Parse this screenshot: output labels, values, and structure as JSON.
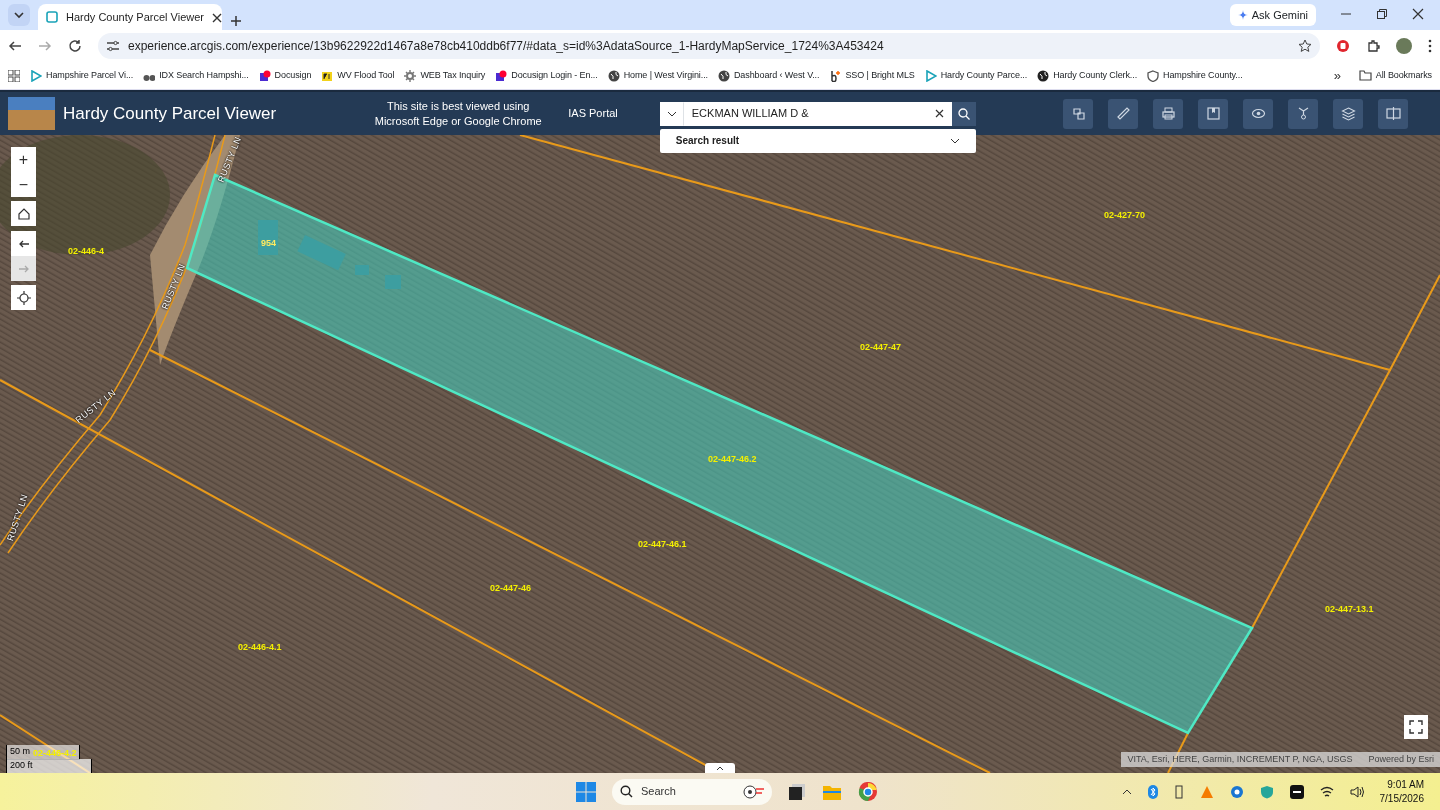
{
  "browser": {
    "tabs": [
      {
        "title": "Hardy County Parcel Viewer",
        "selected": true
      }
    ],
    "ask_gemini": "Ask Gemini",
    "url": "experience.arcgis.com/experience/13b9622922d1467a8e78cb410ddb6f77/#data_s=id%3AdataSource_1-HardyMapService_1724%3A453424",
    "bookmarks": [
      "Hampshire Parcel Vi...",
      "IDX Search Hampshi...",
      "Docusign",
      "WV Flood Tool",
      "WEB Tax Inquiry",
      "Docusign Login - En...",
      "Home | West Virgini...",
      "Dashboard ‹ West V...",
      "SSO | Bright MLS",
      "Hardy County Parce...",
      "Hardy County Clerk...",
      "Hampshire County..."
    ],
    "more_bookmarks": "»",
    "all_bookmarks": "All Bookmarks"
  },
  "app": {
    "title": "Hardy County Parcel Viewer",
    "notice": "This site is best viewed using Microsoft Edge or Google Chrome",
    "portal_link": "IAS Portal",
    "search": {
      "value": "ECKMAN WILLIAM D &"
    },
    "search_result": "Search result"
  },
  "map": {
    "controls": [
      {
        "label": "+",
        "disabled": false
      },
      {
        "label": "−",
        "disabled": false
      },
      {
        "disabled": false
      },
      {
        "disabled": false
      },
      {
        "disabled": true
      },
      {
        "disabled": false
      }
    ],
    "parcel_labels": [
      "02-446-4",
      "02-427-70",
      "02-447-47",
      "02-447-46.2",
      "02-447-46.1",
      "02-447-46",
      "02-446-4.1",
      "02-447-13.1",
      "02-446-4.2"
    ],
    "address_label": "954",
    "road_labels": [
      "RUSTY LN",
      "RUSTY LN",
      "RUSTY LN",
      "RUSTY LN"
    ],
    "scale": {
      "metric": "50 m",
      "imperial": "200 ft"
    },
    "attribution": "VITA, Esri, HERE, Garmin, INCREMENT P, NGA, USGS",
    "powered_by": "Powered by Esri"
  },
  "taskbar": {
    "search_placeholder": "Search",
    "time": "9:01 AM",
    "date": "7/15/2026"
  }
}
